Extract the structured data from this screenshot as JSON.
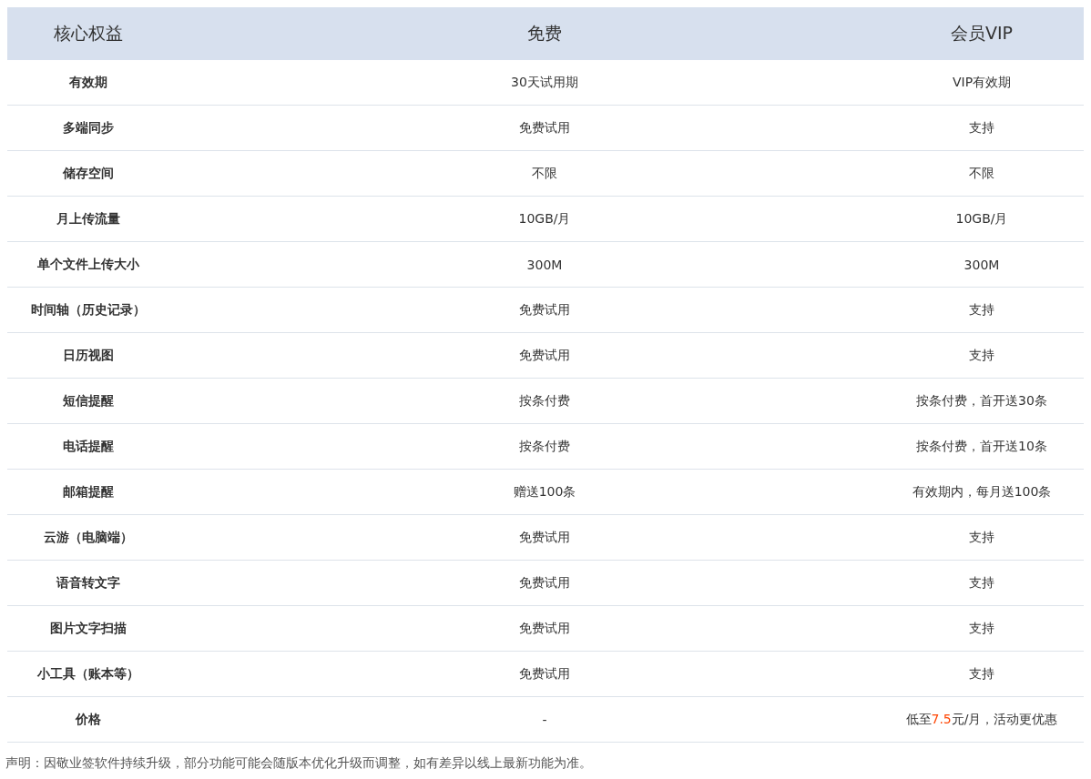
{
  "table": {
    "columns": [
      "核心权益",
      "免费",
      "会员VIP"
    ],
    "rows": [
      {
        "feature": "有效期",
        "free": "30天试用期",
        "vip": "VIP有效期"
      },
      {
        "feature": "多端同步",
        "free": "免费试用",
        "vip": "支持"
      },
      {
        "feature": "储存空间",
        "free": "不限",
        "vip": "不限"
      },
      {
        "feature": "月上传流量",
        "free": "10GB/月",
        "vip": "10GB/月"
      },
      {
        "feature": "单个文件上传大小",
        "free": "300M",
        "vip": "300M"
      },
      {
        "feature": "时间轴（历史记录）",
        "free": "免费试用",
        "vip": "支持"
      },
      {
        "feature": "日历视图",
        "free": "免费试用",
        "vip": "支持"
      },
      {
        "feature": "短信提醒",
        "free": "按条付费",
        "vip": "按条付费，首开送30条"
      },
      {
        "feature": "电话提醒",
        "free": "按条付费",
        "vip": "按条付费，首开送10条"
      },
      {
        "feature": "邮箱提醒",
        "free": "赠送100条",
        "vip": "有效期内，每月送100条"
      },
      {
        "feature": "云游（电脑端）",
        "free": "免费试用",
        "vip": "支持"
      },
      {
        "feature": "语音转文字",
        "free": "免费试用",
        "vip": "支持"
      },
      {
        "feature": "图片文字扫描",
        "free": "免费试用",
        "vip": "支持"
      },
      {
        "feature": "小工具（账本等）",
        "free": "免费试用",
        "vip": "支持"
      },
      {
        "feature": "价格",
        "free": "-",
        "vip": "低至",
        "vip_highlight": "7.5",
        "vip_after": "元/月，活动更优惠"
      }
    ]
  },
  "footnote": "声明：因敬业签软件持续升级，部分功能可能会随版本优化升级而调整，如有差异以线上最新功能为准。"
}
